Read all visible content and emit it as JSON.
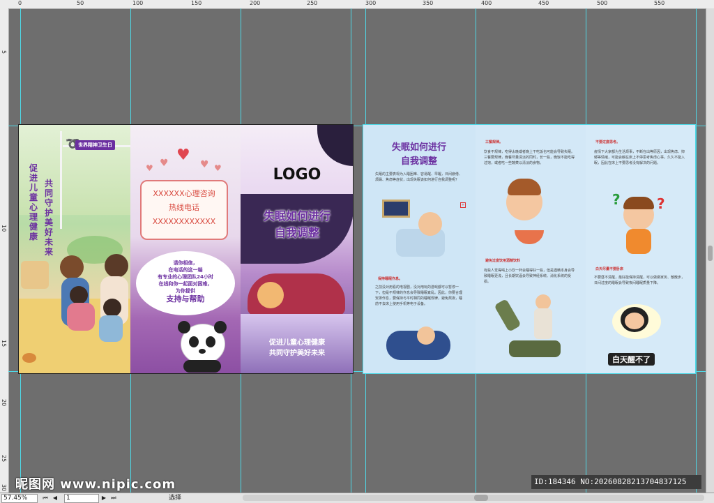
{
  "rulers": {
    "top": [
      "0",
      "50",
      "100",
      "150",
      "200",
      "250",
      "300",
      "350",
      "400",
      "450",
      "500",
      "550"
    ],
    "left": [
      "5",
      "10",
      "15",
      "20",
      "25",
      "30"
    ]
  },
  "panel1": {
    "badge": "世界精神卫生日",
    "v1": "促进儿童心理健康",
    "v2": "共同守护美好未来"
  },
  "panel2": {
    "box_line1": "XXXXXX心理咨询",
    "box_line2": "热线电话",
    "box_line3": "XXXXXXXXXXXX",
    "bubble_l1": "请你相信，",
    "bubble_l2": "在电话的这一端",
    "bubble_l3": "有专业的心理团队24小时",
    "bubble_l4": "在线和你一起面对困难，",
    "bubble_l5": "为你提供",
    "bubble_strong": "支持与帮助"
  },
  "panel3": {
    "logo": "LOGO",
    "title_l1": "失眠如何进行",
    "title_l2": "自我调整",
    "bottom_l1": "促进儿童心理健康",
    "bottom_l2": "共同守护美好未来"
  },
  "panel4": {
    "title_l1": "失眠如何进行",
    "title_l2": "自我调整",
    "intro": "失眠的主要表现为入睡困难、容易醒、早醒，日间疲倦、烦躁、焦虑等症状，出现失眠该如何进行自我调整呢？",
    "sec": "保持睡眠作息。",
    "sec_body": "之前没对用看的电视剧，没对用玩的游戏都可以暂停一下，但是不规律的作息会导致睡眠紊乱。因此，你要合理安排作息，要保持与平时相同的睡眠规律，避免熬夜，睡前不去床上使用手机等电子设备。"
  },
  "panel5": {
    "sec1": "三餐规律。",
    "sec1_body": "饮食不规律，吃得太晚或者晚上干吃饭也可能会导致失眠。三餐要规律，晚餐尽量清淡的同时，长一些，晚饭不能吃得过饱，或者吃一些蔬菜以清淡的食物。",
    "sec2": "避免过度饮用酒精饮料",
    "sec2_body": "有些人觉得喝上小饮一杯会睡得好一些，但是酒精本身会导致睡眠更浅，且长期饮酒会导致神经系统、消化系统的受损。"
  },
  "panel6": {
    "sec1": "不要过度思考。",
    "sec1_body": "疫情下大家都为生活烦事，不断在出等原因，出现焦虑、抑郁等情绪，可能会躺在床上不停思考焦虑心事，久久不能入眠，因此在床上不要思考没有解决的问题。",
    "sec2": "白天尽量不要卧床",
    "sec2_body": "不要昼不清醒，最好能保持清醒，可以做做家务、散散步，日间过度的睡眠会导致夜间睡眠质量下降。",
    "caption": "白天醒不了"
  },
  "status": {
    "zoom": "57.45%",
    "page": "1",
    "mode": "选择"
  },
  "watermark": {
    "site": "昵图网 www.nipic.com",
    "id": "ID:184346 NO:20260828213704837125"
  }
}
